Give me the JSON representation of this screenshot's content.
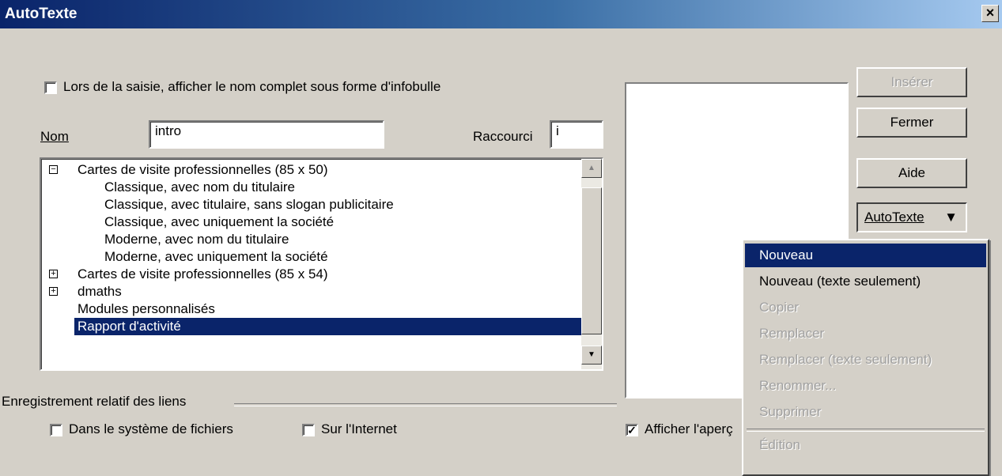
{
  "window": {
    "title": "AutoTexte",
    "close_symbol": "×"
  },
  "options": {
    "show_tooltip_label": "Lors de la saisie, afficher le nom complet sous forme d'infobulle",
    "show_tooltip_checked": false
  },
  "fields": {
    "name_label": "Nom",
    "name_value": "intro",
    "shortcut_label": "Raccourci",
    "shortcut_value": "i"
  },
  "tree": {
    "items": [
      {
        "label": "Cartes de visite professionnelles (85 x 50)",
        "toggle": "⊟",
        "level": 0
      },
      {
        "label": "Classique, avec nom du titulaire",
        "level": 1
      },
      {
        "label": "Classique, avec titulaire, sans slogan publicitaire",
        "level": 1
      },
      {
        "label": "Classique, avec uniquement la société",
        "level": 1
      },
      {
        "label": "Moderne, avec nom du titulaire",
        "level": 1
      },
      {
        "label": "Moderne, avec uniquement la société",
        "level": 1
      },
      {
        "label": "Cartes de visite professionnelles (85 x 54)",
        "toggle": "⊞",
        "level": 0
      },
      {
        "label": "dmaths",
        "toggle": "⊞",
        "level": 0
      },
      {
        "label": "Modules personnalisés",
        "level": 0
      },
      {
        "label": "Rapport d'activité",
        "level": 0,
        "selected": true
      }
    ],
    "scroll_up": "▲",
    "scroll_down": "▼"
  },
  "links": {
    "group_label": "Enregistrement relatif des liens",
    "filesystem_label": "Dans le système de fichiers",
    "filesystem_checked": false,
    "internet_label": "Sur l'Internet",
    "internet_checked": false
  },
  "preview": {
    "show_label": "Afficher l'aperç",
    "show_checked": true,
    "check_mark": "✓"
  },
  "buttons": {
    "insert": "Insérer",
    "close": "Fermer",
    "help": "Aide",
    "autotext": "AutoTexte",
    "autotext_arrow": "▼"
  },
  "menu": {
    "items": [
      {
        "label": "Nouveau",
        "state": "selected"
      },
      {
        "label": "Nouveau (texte seulement)",
        "state": "enabled"
      },
      {
        "label": "Copier",
        "state": "disabled"
      },
      {
        "label": "Remplacer",
        "state": "disabled"
      },
      {
        "label": "Remplacer (texte seulement)",
        "state": "disabled"
      },
      {
        "label": "Renommer...",
        "state": "disabled"
      },
      {
        "label": "Supprimer",
        "state": "disabled"
      },
      {
        "label": "Édition",
        "state": "disabled"
      }
    ]
  },
  "colors": {
    "titlebar": "#0a246a",
    "selection": "#0a246a",
    "face": "#d4d0c8"
  }
}
